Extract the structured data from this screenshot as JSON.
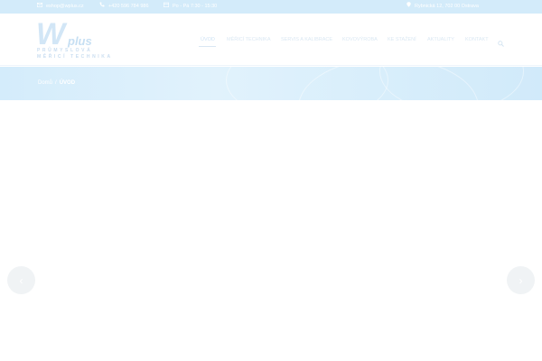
{
  "topbar": {
    "email": "eshop@wplus.cz",
    "phone": "+420 596 784 986",
    "hours": "Po - Pá  7:30 - 15:30",
    "address": "Rybnická 12, 702 00 Ostrava"
  },
  "logo": {
    "mark": "W",
    "suffix": "plus",
    "line1": "PRŮMYSLOVÁ",
    "line2": "MĚŘICÍ TECHNIKA"
  },
  "nav": {
    "items": [
      {
        "label": "ÚVOD",
        "active": true
      },
      {
        "label": "MĚŘICÍ TECHNIKA",
        "active": false
      },
      {
        "label": "SERVIS A KALIBRACE",
        "active": false
      },
      {
        "label": "KOVOVÝROBA",
        "active": false
      },
      {
        "label": "KE STAŽENÍ",
        "active": false
      },
      {
        "label": "AKTUALITY",
        "active": false
      },
      {
        "label": "KONTAKT",
        "active": false
      }
    ],
    "search_icon": "search-icon"
  },
  "breadcrumb": {
    "home": "Domů",
    "separator": "/",
    "current": "ÚVOD"
  },
  "slider": {
    "prev_icon": "chevron-left-icon",
    "next_icon": "chevron-right-icon",
    "prev_glyph": "‹",
    "next_glyph": "›"
  },
  "colors": {
    "topbar_bg": "#d3ebfa",
    "banner_bg": "#d8eefb",
    "nav_text": "#dbe8f3",
    "arrow_bg": "#f0f3f5"
  }
}
